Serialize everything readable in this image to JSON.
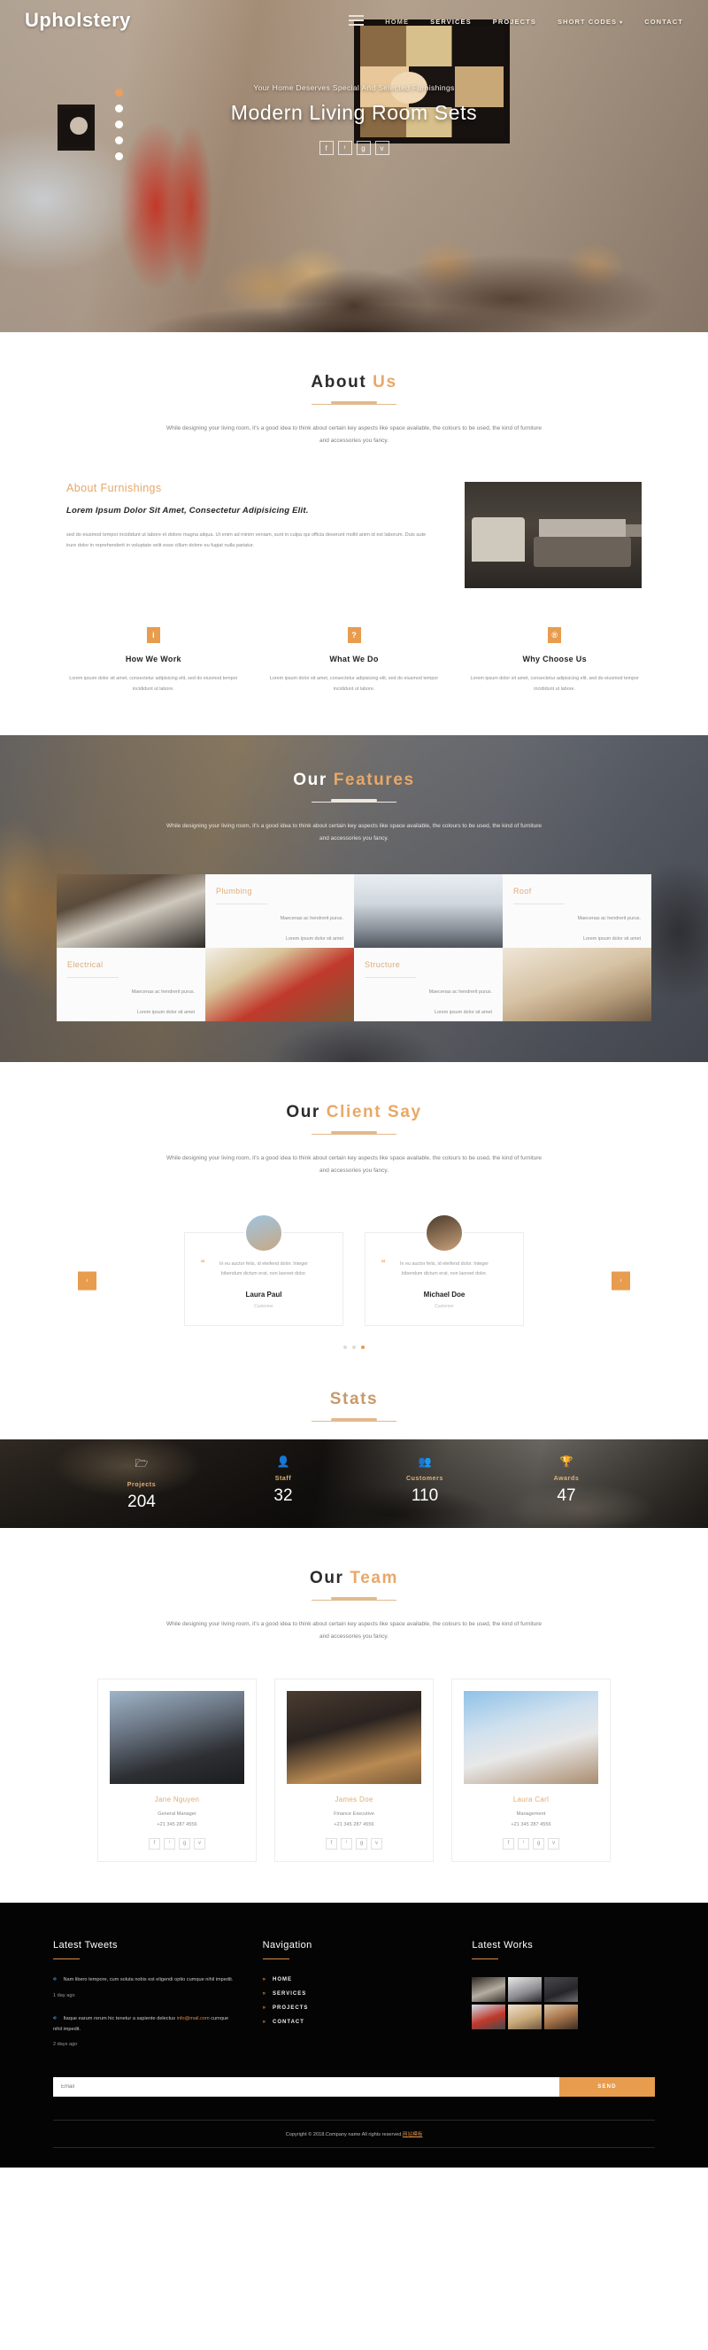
{
  "hero": {
    "brand": "Upholstery",
    "nav": [
      {
        "label": "HOME",
        "active": true
      },
      {
        "label": "SERVICES",
        "active": false
      },
      {
        "label": "PROJECTS",
        "active": false
      },
      {
        "label": "SHORT CODES",
        "active": false,
        "caret": "▾"
      },
      {
        "label": "CONTACT",
        "active": false
      }
    ],
    "subtitle": "Your Home Deserves Special And Selected Furnishings",
    "title": "Modern Living Room Sets",
    "social": [
      {
        "name": "facebook-icon",
        "glyph": "f"
      },
      {
        "name": "twitter-icon",
        "glyph": "ᵗ"
      },
      {
        "name": "google-plus-icon",
        "glyph": "g"
      },
      {
        "name": "vimeo-icon",
        "glyph": "v"
      }
    ]
  },
  "about": {
    "title_a": "About ",
    "title_b": "Us",
    "desc": "While designing your living room, it's a good idea to think about certain key aspects like space available, the colours to be used, the kind of furniture and accessories you fancy.",
    "kicker": "About Furnishings",
    "heading": "Lorem Ipsum Dolor Sit Amet, Consectetur Adipisicing Elit.",
    "body": "sed do eiusmod tempor incididunt ut labore et dolore magna aliqua. Ut enim ad minim veniam, sunt in culpa qui officia deserunt mollit anim id est laborum. Duis aute irure dolor in reprehenderit in voluptate velit esse cillum dolore eu fugiat nulla pariatur.",
    "columns": [
      {
        "icon": "info-icon",
        "glyph": "i",
        "title": "How We Work",
        "desc": "Lorem ipsum dolor sit amet, consectetur adipisicing elit, sed do eiusmod tempor incididunt ut labore."
      },
      {
        "icon": "question-icon",
        "glyph": "?",
        "title": "What We Do",
        "desc": "Lorem ipsum dolor sit amet, consectetur adipisicing elit, sed do eiusmod tempor incididunt ut labore."
      },
      {
        "icon": "registered-icon",
        "glyph": "®",
        "title": "Why Choose Us",
        "desc": "Lorem ipsum dolor sit amet, consectetur adipisicing elit, sed do eiusmod tempor incididunt ut labore."
      }
    ]
  },
  "features": {
    "title_a": "Our ",
    "title_b": "Features",
    "desc": "While designing your living room, it's a good idea to think about certain key aspects like space available, the colours to be used, the kind of furniture and accessories you fancy.",
    "cards": [
      {
        "title": "Plumbing",
        "line1": "Maecenas ac hendrerit purus.",
        "line2": "Lorem ipsum dolor sit amet"
      },
      {
        "title": "Roof",
        "line1": "Maecenas ac hendrerit purus.",
        "line2": "Lorem ipsum dolor sit amet"
      },
      {
        "title": "Electrical",
        "line1": "Maecenas ac hendrerit purus.",
        "line2": "Lorem ipsum dolor sit amet"
      },
      {
        "title": "Structure",
        "line1": "Maecenas ac hendrerit purus.",
        "line2": "Lorem ipsum dolor sit amet"
      }
    ]
  },
  "testimonials": {
    "title_a": "Our ",
    "title_b": "Client Say",
    "desc": "While designing your living room, it's a good idea to think about certain key aspects like space available, the colours to be used, the kind of furniture and accessories you fancy.",
    "items": [
      {
        "quote": "In eu auctor felis, id eleifend dolor. Integer bibendum dictum erat, non laoreet dolor.",
        "name": "Laura Paul",
        "role": "Customer"
      },
      {
        "quote": "In eu auctor felis, id eleifend dolor. Integer bibendum dictum erat, non laoreet dolor.",
        "name": "Michael Doe",
        "role": "Customer"
      }
    ],
    "prev": "‹",
    "next": "›"
  },
  "stats": {
    "title": "Stats",
    "items": [
      {
        "icon": "folder-icon",
        "glyph": "🗁",
        "label": "Projects",
        "value": "204"
      },
      {
        "icon": "user-icon",
        "glyph": "👤",
        "label": "Staff",
        "value": "32"
      },
      {
        "icon": "users-icon",
        "glyph": "👥",
        "label": "Customers",
        "value": "110"
      },
      {
        "icon": "trophy-icon",
        "glyph": "🏆",
        "label": "Awards",
        "value": "47"
      }
    ]
  },
  "team": {
    "title_a": "Our ",
    "title_b": "Team",
    "desc": "While designing your living room, it's a good idea to think about certain key aspects like space available, the colours to be used, the kind of furniture and accessories you fancy.",
    "members": [
      {
        "name": "Jane Nguyen",
        "role": "General Manager",
        "phone": "+21 345 287 4556"
      },
      {
        "name": "James Doe",
        "role": "Finance Executive",
        "phone": "+21 345 287 4556"
      },
      {
        "name": "Laura Carl",
        "role": "Management",
        "phone": "+21 345 287 4556"
      }
    ],
    "social": [
      {
        "name": "facebook-icon",
        "glyph": "f"
      },
      {
        "name": "twitter-icon",
        "glyph": "ᵗ"
      },
      {
        "name": "google-plus-icon",
        "glyph": "g"
      },
      {
        "name": "vimeo-icon",
        "glyph": "v"
      }
    ]
  },
  "footer": {
    "tweets_title": "Latest Tweets",
    "tweets": [
      {
        "text": "Nam libero tempore, cum soluta nobis est eligendi optio cumque nihil impedit.",
        "link": "",
        "tail": "",
        "ago": "1 day ago"
      },
      {
        "text": "Itaque earum rerum hic tenetur a sapiente delectus ",
        "link": "info@mail.com",
        "tail": " cumque nihil impedit.",
        "ago": "2 days ago"
      }
    ],
    "nav_title": "Navigation",
    "nav": [
      "HOME",
      "SERVICES",
      "PROJECTS",
      "CONTACT"
    ],
    "works_title": "Latest Works",
    "newsletter_placeholder": "Email",
    "newsletter_button": "SEND",
    "copyright": "Copyright © 2018.Company name All rights reserved.",
    "copyright_link": "网站模板"
  },
  "colors": {
    "accent": "#e79c4e",
    "accent_light": "#e3ab72",
    "dark": "#040404"
  }
}
